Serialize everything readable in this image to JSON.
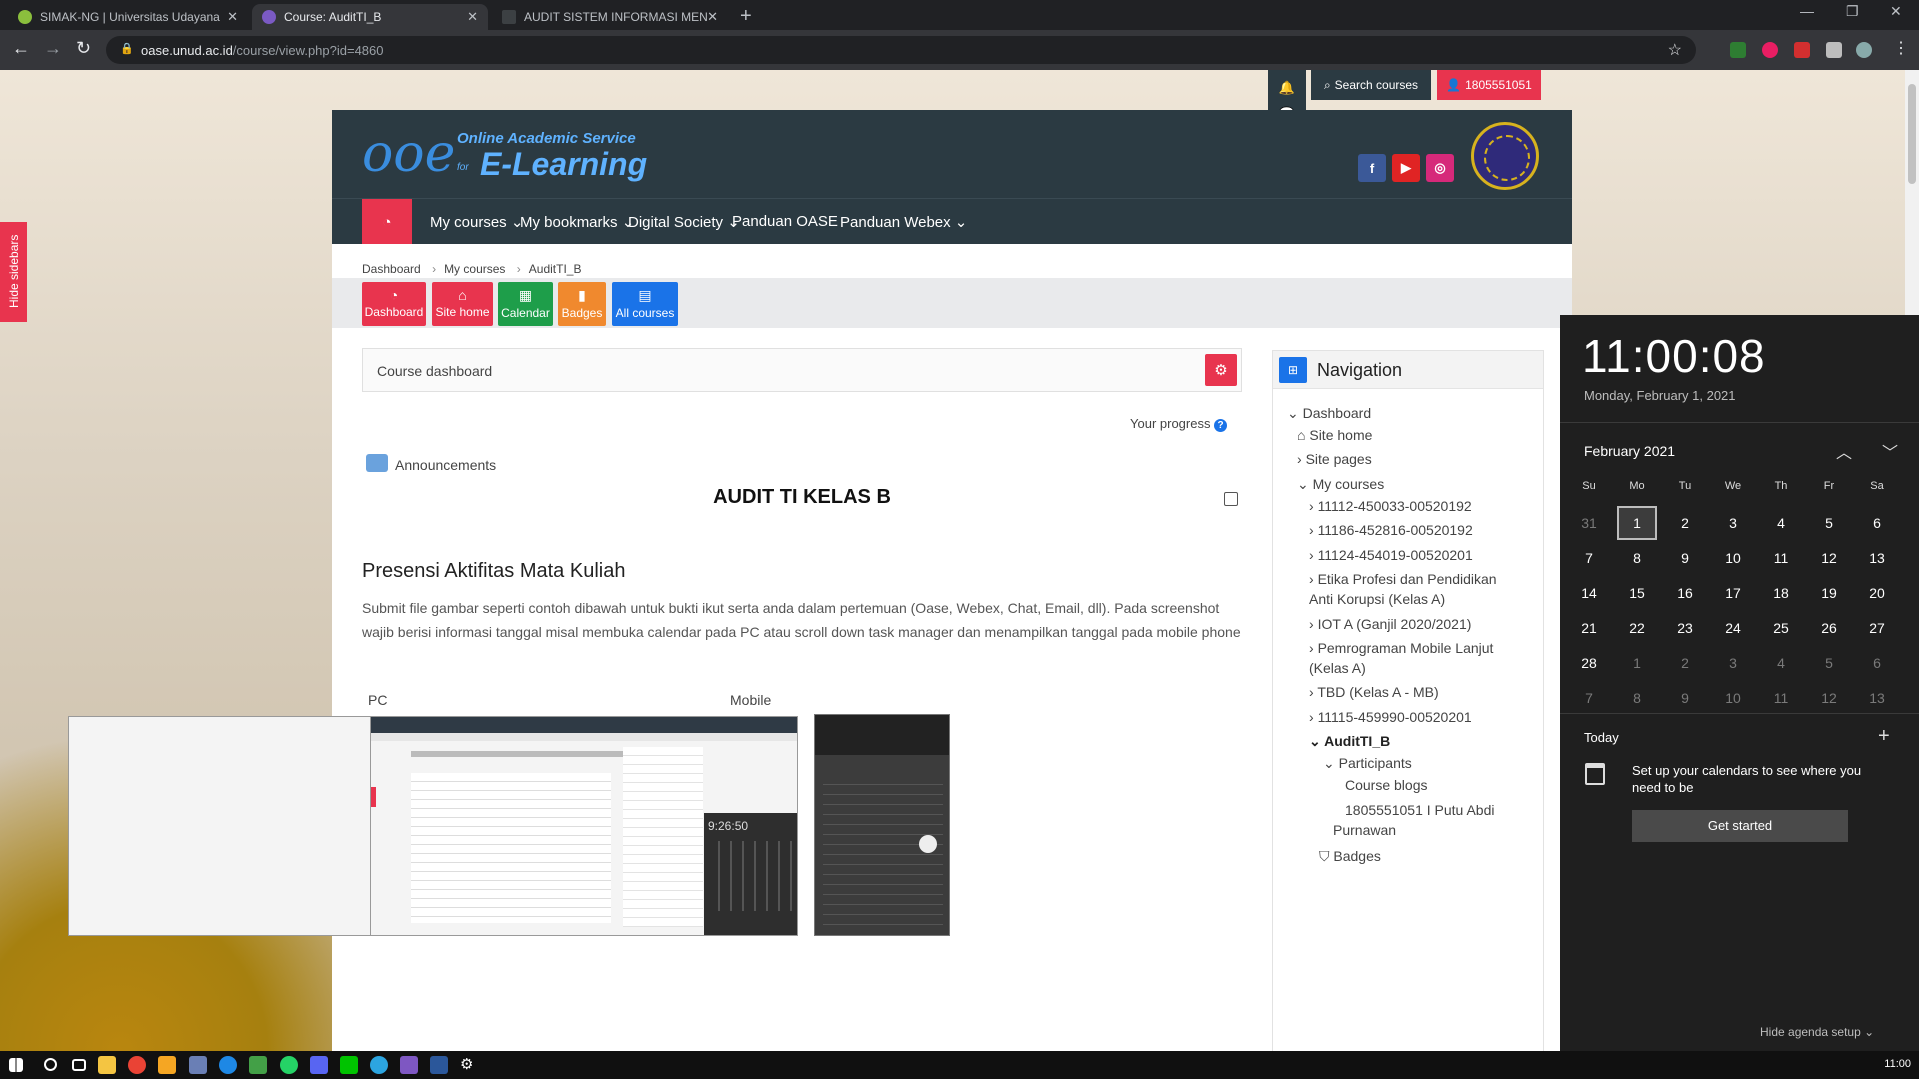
{
  "browser": {
    "tabs": [
      {
        "title": "SIMAK-NG | Universitas Udayana",
        "active": false
      },
      {
        "title": "Course: AuditTI_B",
        "active": true
      },
      {
        "title": "AUDIT SISTEM INFORMASI MEN",
        "active": false
      }
    ],
    "url_host": "oase.unud.ac.id",
    "url_path": "/course/view.php?id=4860"
  },
  "hide_sidebars": "Hide sidebars",
  "topbar": {
    "search_courses": "Search courses",
    "user": "1805551051"
  },
  "header": {
    "logo_line1": "Online Academic Service",
    "logo_line2": "E-Learning",
    "logo_for": "for"
  },
  "menu": {
    "items": [
      "My courses",
      "My bookmarks",
      "Digital Society",
      "Panduan OASE",
      "Panduan Webex"
    ]
  },
  "breadcrumb": [
    "Dashboard",
    "My courses",
    "AuditTI_B"
  ],
  "quick_buttons": [
    {
      "label": "Dashboard",
      "color": "#e8344e"
    },
    {
      "label": "Site home",
      "color": "#e8344e"
    },
    {
      "label": "Calendar",
      "color": "#1e9e4a"
    },
    {
      "label": "Badges",
      "color": "#f0892e"
    },
    {
      "label": "All courses",
      "color": "#1a73e8"
    }
  ],
  "course": {
    "dashboard_label": "Course dashboard",
    "progress_label": "Your progress",
    "announcements": "Announcements",
    "title": "AUDIT TI KELAS B",
    "section_title": "Presensi Aktifitas Mata Kuliah",
    "section_desc": "Submit file gambar seperti contoh dibawah untuk bukti ikut serta anda dalam pertemuan (Oase, Webex, Chat, Email, dll). Pada screenshot wajib berisi informasi tanggal misal membuka calendar pada PC atau scroll down task manager dan menampilkan tanggal pada mobile phone",
    "label_pc": "PC",
    "label_mobile": "Mobile",
    "example_time": "9:26:50"
  },
  "navigation": {
    "title": "Navigation",
    "items": [
      "Dashboard",
      "Site home",
      "Site pages",
      "My courses",
      "11112-450033-00520192",
      "11186-452816-00520192",
      "11124-454019-00520201",
      "Etika Profesi dan Pendidikan",
      "Anti Korupsi (Kelas A)",
      "IOT A (Ganjil 2020/2021)",
      "Pemrograman Mobile Lanjut",
      "(Kelas A)",
      "TBD (Kelas A - MB)",
      "11115-459990-00520201",
      "AuditTI_B",
      "Participants",
      "Course blogs",
      "1805551051 I Putu Abdi",
      "Purnawan",
      "Badges"
    ]
  },
  "flyout": {
    "time": "11:00:08",
    "date": "Monday, February 1, 2021",
    "month": "February 2021",
    "weekdays": [
      "Su",
      "Mo",
      "Tu",
      "We",
      "Th",
      "Fr",
      "Sa"
    ],
    "weeks": [
      [
        "31",
        "1",
        "2",
        "3",
        "4",
        "5",
        "6"
      ],
      [
        "7",
        "8",
        "9",
        "10",
        "11",
        "12",
        "13"
      ],
      [
        "14",
        "15",
        "16",
        "17",
        "18",
        "19",
        "20"
      ],
      [
        "21",
        "22",
        "23",
        "24",
        "25",
        "26",
        "27"
      ],
      [
        "28",
        "1",
        "2",
        "3",
        "4",
        "5",
        "6"
      ],
      [
        "7",
        "8",
        "9",
        "10",
        "11",
        "12",
        "13"
      ]
    ],
    "today_label": "Today",
    "setup_text": "Set up your calendars to see where you need to be",
    "get_started": "Get started",
    "hide_agenda": "Hide agenda setup"
  },
  "taskbar": {
    "time": "11:00"
  }
}
